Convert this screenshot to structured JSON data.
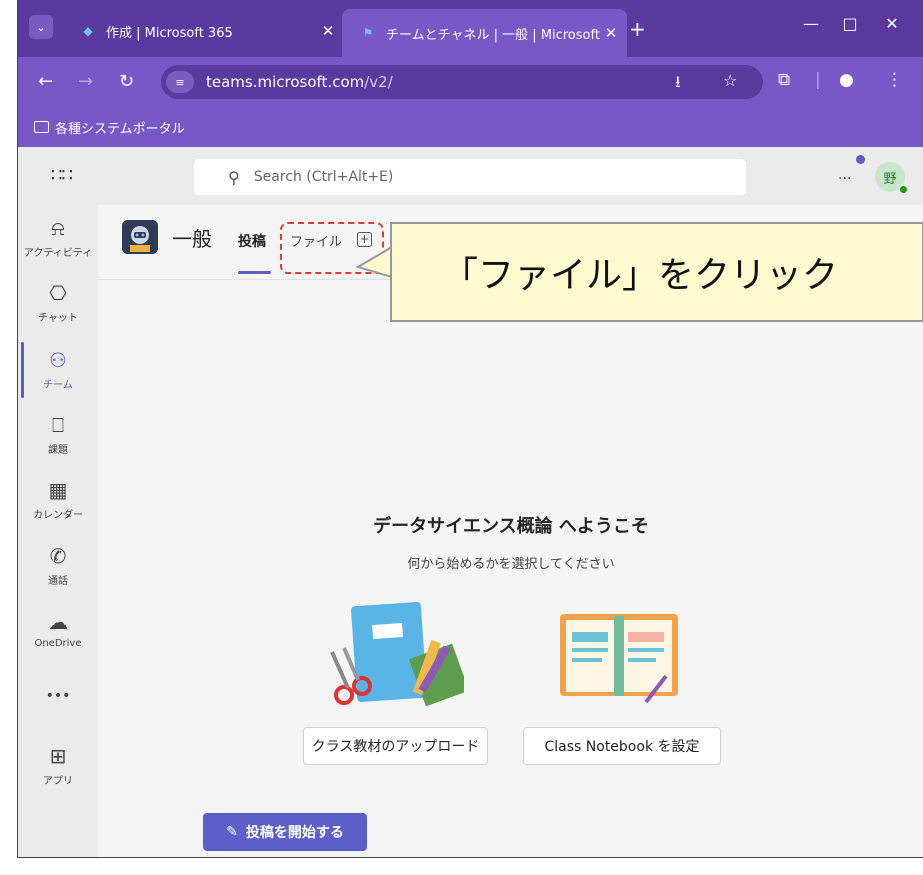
{
  "browser": {
    "tabs": [
      {
        "title": "作成 | Microsoft 365",
        "icon": "microsoft365-icon"
      },
      {
        "title": "チームとチャネル | 一般 | Microsoft",
        "icon": "teams-icon"
      }
    ],
    "new_tab": "+",
    "url_host": "teams.microsoft.com",
    "url_path": "/v2/",
    "bookmark_folder": "各種システムポータル"
  },
  "teams": {
    "search_placeholder": "Search (Ctrl+Alt+E)",
    "more": "...",
    "avatar_text": "野",
    "rail": [
      {
        "label": "アクティビティ",
        "icon": "bell-icon"
      },
      {
        "label": "チャット",
        "icon": "chat-icon"
      },
      {
        "label": "チーム",
        "icon": "teams-icon"
      },
      {
        "label": "課題",
        "icon": "backpack-icon"
      },
      {
        "label": "カレンダー",
        "icon": "calendar-icon"
      },
      {
        "label": "通話",
        "icon": "phone-icon"
      },
      {
        "label": "OneDrive",
        "icon": "cloud-icon"
      },
      {
        "label": "•••",
        "icon": "more-icon"
      },
      {
        "label": "アプリ",
        "icon": "add-app-icon"
      }
    ],
    "channel": {
      "name": "一般",
      "tabs": [
        "投稿",
        "ファイル"
      ]
    },
    "callout": "「ファイル」をクリック",
    "welcome": {
      "title": "データサイエンス概論 へようこそ",
      "subtitle": "何から始めるかを選択してください",
      "upload_button": "クラス教材のアップロード",
      "notebook_button": "Class Notebook を設定",
      "start_post_button": "投稿を開始する"
    }
  },
  "colors": {
    "browser_purple": "#7a57c7",
    "teams_accent": "#5b5fc7",
    "callout_bg": "#fffbd0",
    "highlight_red": "#e53935"
  }
}
